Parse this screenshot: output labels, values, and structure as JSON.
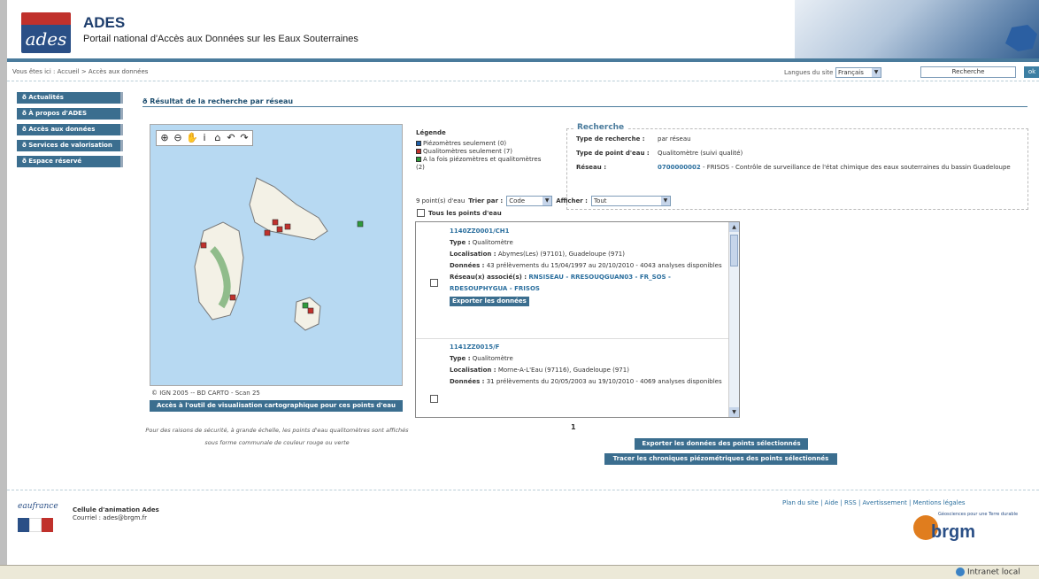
{
  "header": {
    "logo_text": "ades",
    "title": "ADES",
    "subtitle": "Portail national d'Accès aux Données sur les Eaux Souterraines"
  },
  "breadcrumb": "Vous êtes ici : Accueil > Accès aux données",
  "lang": {
    "label": "Langues du site",
    "value": "Français"
  },
  "search": {
    "value": "Recherche",
    "button": "ok"
  },
  "nav": [
    "ð Actualités",
    "ð À propos d'ADES",
    "ð Accès aux données",
    "ð Services de valorisation",
    "ð Espace réservé"
  ],
  "page_title": "ð Résultat de la recherche par réseau",
  "map": {
    "copyright": "© IGN 2005 -- BD CARTO - Scan 25",
    "button": "Accès à l'outil de visualisation cartographique pour ces points d'eau",
    "note": "Pour des raisons de sécurité, à grande échelle, les points d'eau qualitomètres sont affichés sous forme communale de couleur rouge ou verte"
  },
  "legend": {
    "title": "Légende",
    "items": [
      {
        "label": "Piézomètres seulement (0)",
        "color": "#1f5fa8"
      },
      {
        "label": "Qualitomètres seulement (7)",
        "color": "#c0312c"
      },
      {
        "label": "A la fois piézomètres et qualitomètres (2)",
        "color": "#2e9a3a"
      }
    ]
  },
  "recherche": {
    "title": "Recherche",
    "rows": [
      {
        "key": "Type de recherche :",
        "value": "par réseau"
      },
      {
        "key": "Type de point d'eau :",
        "value": "Qualitomètre (suivi qualité)"
      },
      {
        "key": "Réseau :",
        "code": "0700000002",
        "value": " - FRISOS - Contrôle de surveillance de l'état chimique des eaux souterraines du bassin Guadeloupe"
      }
    ]
  },
  "controls": {
    "count": "9 point(s) d'eau",
    "sort_label": "Trier par :",
    "sort_value": "Code",
    "show_label": "Afficher :",
    "show_value": "Tout",
    "all_points": "Tous les points d'eau"
  },
  "results": [
    {
      "code": "1140ZZ0001/CH1",
      "type_label": "Type :",
      "type": "Qualitomètre",
      "loc_label": "Localisation :",
      "loc": "Abymes(Les) (97101), Guadeloupe (971)",
      "data_label": "Données :",
      "data": "43 prélèvements du 15/04/1997 au 20/10/2010 - 4043 analyses disponibles",
      "net_label": "Réseau(x) associé(s) :",
      "nets": "RNSISEAU - RRESOUQGUAN03 - FR_SOS - RDESOUPHYGUA - FRISOS",
      "export": "Exporter les données"
    },
    {
      "code": "1141ZZ0015/F",
      "type_label": "Type :",
      "type": "Qualitomètre",
      "loc_label": "Localisation :",
      "loc": "Morne-A-L'Eau (97116), Guadeloupe (971)",
      "data_label": "Données :",
      "data": "31 prélèvements du 20/05/2003 au 19/10/2010 - 4069 analyses disponibles",
      "net_label": "",
      "nets": "",
      "export": ""
    }
  ],
  "pagination": "1",
  "buttons": {
    "export_selected": "Exporter les données des points sélectionnés",
    "trace": "Tracer les chroniques piézométriques des points sélectionnés"
  },
  "footer": {
    "eaufrance": "eaufrance",
    "cell_title": "Cellule d'animation Ades",
    "cell_mail": "Courriel : ades@brgm.fr",
    "links": "Plan du site | Aide | RSS | Avertissement | Mentions légales",
    "brgm": "brgm",
    "brgm_tag": "Géosciences pour une Terre durable"
  },
  "status": {
    "zone": "Intranet local"
  }
}
